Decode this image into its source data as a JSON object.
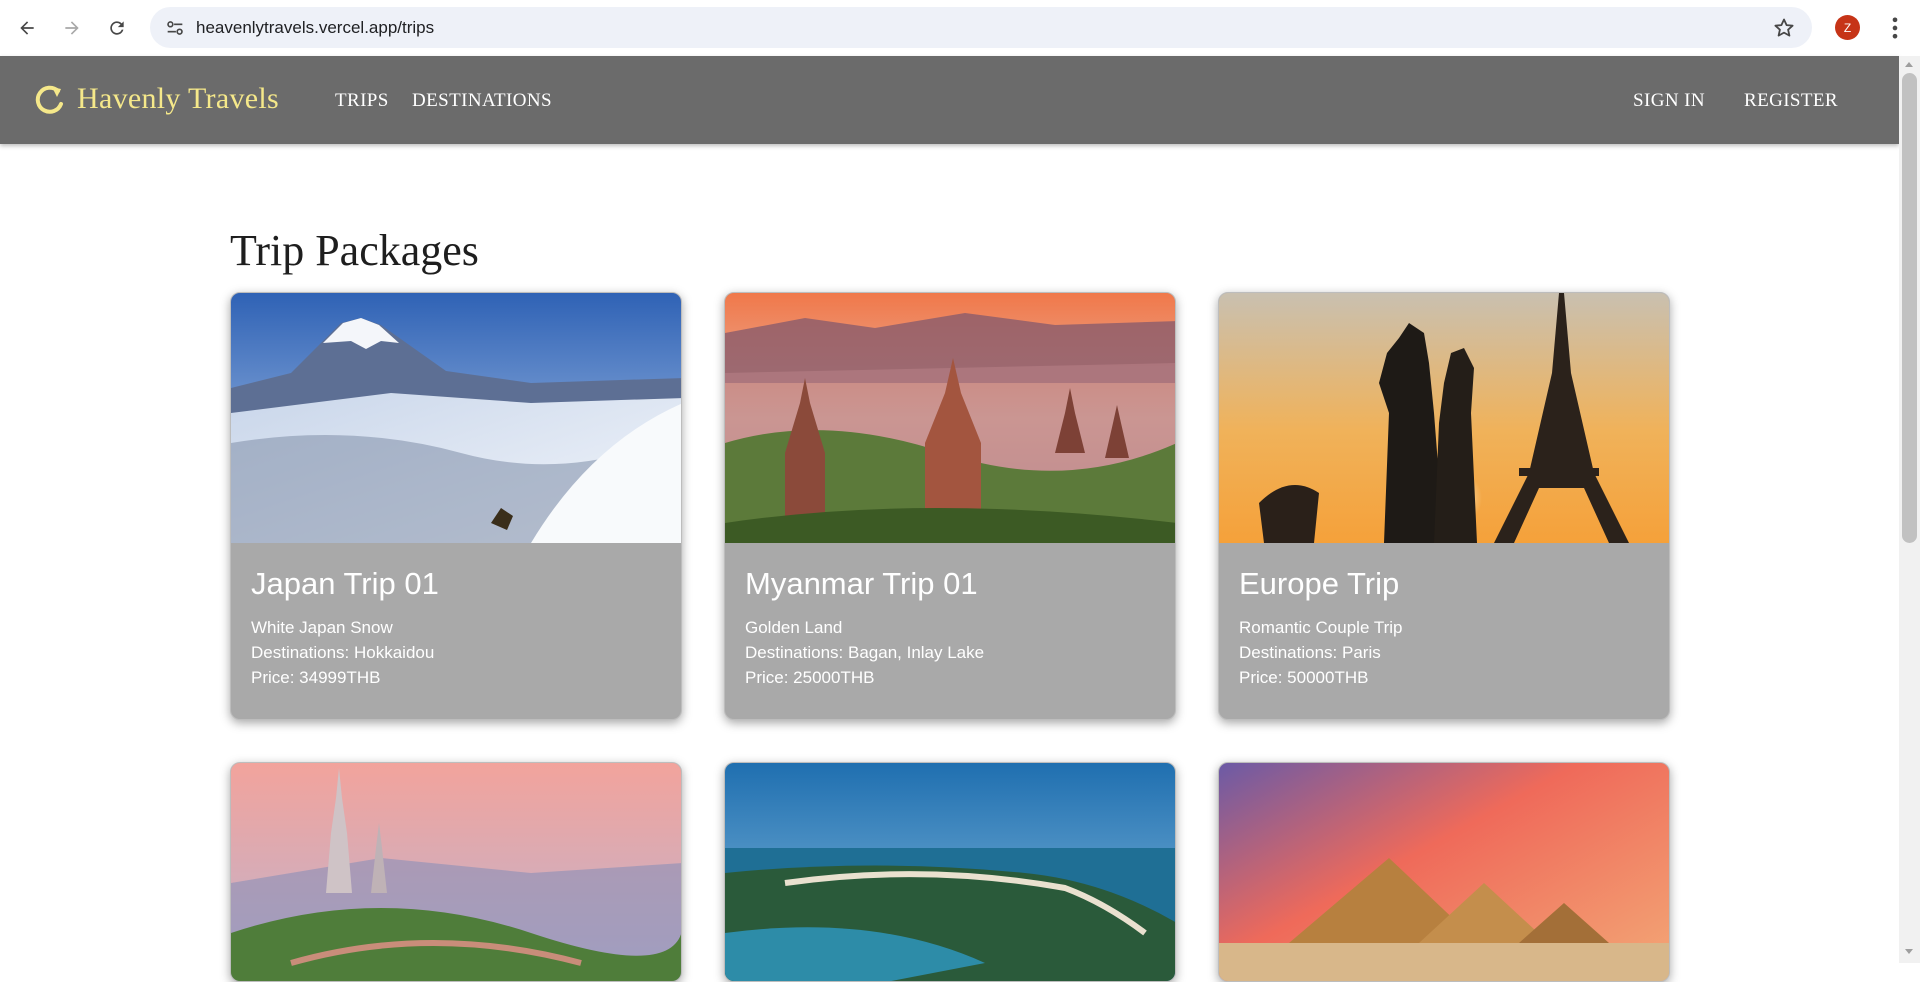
{
  "browser": {
    "url": "heavenlytravels.vercel.app/trips",
    "profile_initial": "Z"
  },
  "header": {
    "brand": "Havenly Travels",
    "nav": {
      "trips": "TRIPS",
      "destinations": "DESTINATIONS",
      "sign_in": "SIGN IN",
      "register": "REGISTER"
    },
    "colors": {
      "bar": "#6b6b6b",
      "brand": "#f5e88a"
    }
  },
  "page": {
    "title": "Trip Packages"
  },
  "trips": [
    {
      "title": "Japan Trip 01",
      "subtitle": "White Japan Snow",
      "destinations": "Destinations: Hokkaidou",
      "price": "Price: 34999THB"
    },
    {
      "title": "Myanmar Trip 01",
      "subtitle": "Golden Land",
      "destinations": "Destinations: Bagan, Inlay Lake",
      "price": "Price: 25000THB"
    },
    {
      "title": "Europe Trip",
      "subtitle": "Romantic Couple Trip",
      "destinations": "Destinations: Paris",
      "price": "Price: 50000THB"
    }
  ]
}
